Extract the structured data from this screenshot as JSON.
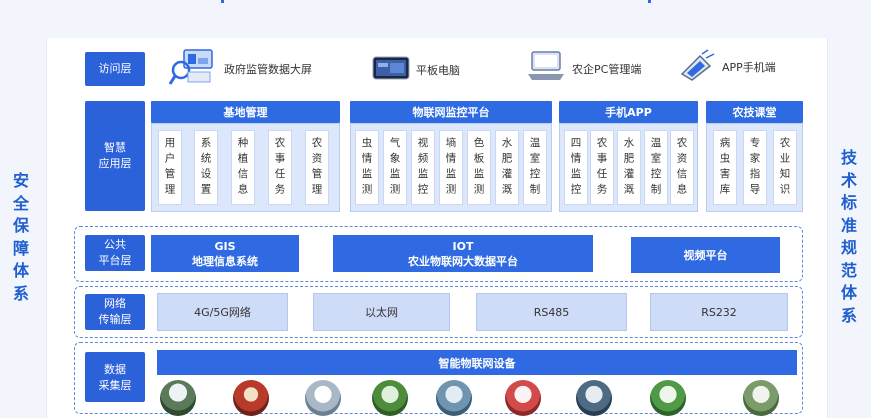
{
  "left_vertical": "安全保障体系",
  "right_vertical": "技术标准规范体系",
  "access_layer": {
    "label": "访问层",
    "items": [
      {
        "label": "政府监管数据大屏",
        "icon": "data-screen-icon"
      },
      {
        "label": "平板电脑",
        "icon": "tablet-icon"
      },
      {
        "label": "农企PC管理端",
        "icon": "pc-icon"
      },
      {
        "label": "APP手机端",
        "icon": "phone-icon"
      }
    ]
  },
  "app_layer": {
    "label_line1": "智慧",
    "label_line2": "应用层",
    "groups": [
      {
        "title": "基地管理",
        "cells": [
          "用户管理",
          "系统设置",
          "种植信息",
          "农事任务",
          "农资管理"
        ]
      },
      {
        "title": "物联网监控平台",
        "cells": [
          "虫情监测",
          "气象监测",
          "视频监控",
          "墒情监测",
          "色板监测",
          "水肥灌溉",
          "温室控制"
        ]
      },
      {
        "title": "手机APP",
        "cells": [
          "四情监控",
          "农事任务",
          "水肥灌溉",
          "温室控制",
          "农资信息"
        ]
      },
      {
        "title": "农技课堂",
        "cells": [
          "病虫害库",
          "专家指导",
          "农业知识"
        ]
      }
    ]
  },
  "platform_layer": {
    "label_line1": "公共",
    "label_line2": "平台层",
    "items": [
      {
        "line1": "GIS",
        "line2": "地理信息系统"
      },
      {
        "line1": "IOT",
        "line2": "农业物联网大数据平台"
      },
      {
        "line1": "视频平台",
        "line2": ""
      }
    ]
  },
  "network_layer": {
    "label_line1": "网络",
    "label_line2": "传输层",
    "items": [
      "4G/5G网络",
      "以太网",
      "RS485",
      "RS232"
    ]
  },
  "collection_layer": {
    "label_line1": "数据",
    "label_line2": "采集层",
    "header": "智能物联网设备"
  },
  "colors": {
    "primary": "#2f6ae2",
    "light": "#dce7fb",
    "text_blue": "#1f5fd1"
  }
}
